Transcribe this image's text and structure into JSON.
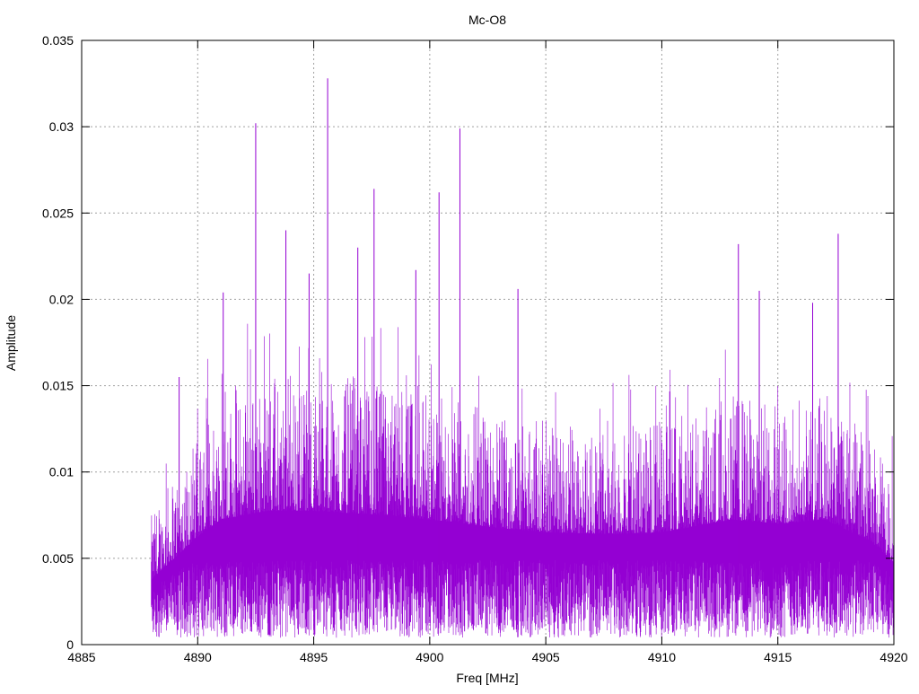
{
  "chart_data": {
    "type": "line",
    "title": "Mc-O8",
    "xlabel": "Freq [MHz]",
    "ylabel": "Amplitude",
    "xlim": [
      4885,
      4920
    ],
    "ylim": [
      0,
      0.035
    ],
    "grid": true,
    "x_ticks": [
      "4885",
      "4890",
      "4895",
      "4900",
      "4905",
      "4910",
      "4915",
      "4920"
    ],
    "x_tick_values": [
      4885,
      4890,
      4895,
      4900,
      4905,
      4910,
      4915,
      4920
    ],
    "y_ticks": [
      "0",
      "0.005",
      "0.01",
      "0.015",
      "0.02",
      "0.025",
      "0.03",
      "0.035"
    ],
    "y_tick_values": [
      0,
      0.005,
      0.01,
      0.015,
      0.02,
      0.025,
      0.03,
      0.035
    ],
    "series_color": "#9400d3",
    "data_range": [
      4888.0,
      4920.0
    ],
    "envelope": {
      "freq": [
        4888,
        4889,
        4890,
        4891,
        4893,
        4895,
        4898,
        4900,
        4903,
        4905,
        4908,
        4910,
        4913,
        4915,
        4917,
        4919,
        4920
      ],
      "typical_max": [
        0.0075,
        0.01,
        0.0125,
        0.0145,
        0.0155,
        0.0155,
        0.015,
        0.0145,
        0.0135,
        0.013,
        0.0128,
        0.013,
        0.0145,
        0.014,
        0.0145,
        0.012,
        0.0095
      ]
    },
    "peaks": [
      {
        "x": 4889.2,
        "y": 0.0155
      },
      {
        "x": 4891.1,
        "y": 0.0204
      },
      {
        "x": 4892.5,
        "y": 0.0302
      },
      {
        "x": 4893.8,
        "y": 0.024
      },
      {
        "x": 4894.8,
        "y": 0.0215
      },
      {
        "x": 4895.6,
        "y": 0.0328
      },
      {
        "x": 4896.9,
        "y": 0.023
      },
      {
        "x": 4897.6,
        "y": 0.0264
      },
      {
        "x": 4899.4,
        "y": 0.0217
      },
      {
        "x": 4900.4,
        "y": 0.0262
      },
      {
        "x": 4901.3,
        "y": 0.0299
      },
      {
        "x": 4903.8,
        "y": 0.0206
      },
      {
        "x": 4913.3,
        "y": 0.0232
      },
      {
        "x": 4914.2,
        "y": 0.0205
      },
      {
        "x": 4916.5,
        "y": 0.0198
      },
      {
        "x": 4917.6,
        "y": 0.0238
      }
    ]
  }
}
